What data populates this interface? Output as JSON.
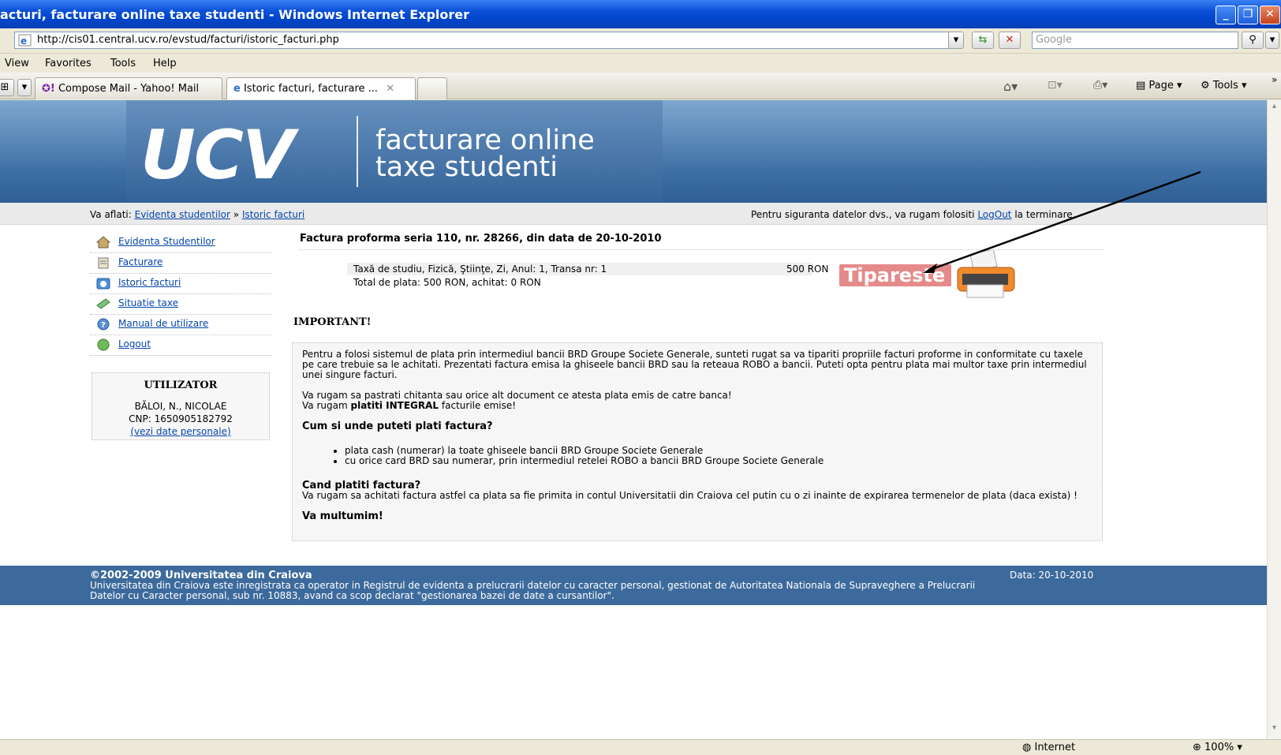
{
  "window": {
    "title": "acturi, facturare online taxe studenti - Windows Internet Explorer"
  },
  "address": {
    "url": "http://cis01.central.ucv.ro/evstud/facturi/istoric_facturi.php",
    "search_placeholder": "Google"
  },
  "menu": {
    "items": [
      "View",
      "Favorites",
      "Tools",
      "Help"
    ]
  },
  "tabs": {
    "items": [
      {
        "label": "Compose Mail - Yahoo! Mail"
      },
      {
        "label": "Istoric facturi, facturare ..."
      }
    ],
    "toolbar": {
      "page_label": "Page",
      "tools_label": "Tools"
    }
  },
  "banner": {
    "logo": "UCV",
    "line1": "facturare online",
    "line2": "taxe studenti"
  },
  "breadcrumb": {
    "prefix": "Va aflati:",
    "item1": "Evidenta studentilor",
    "sep": "»",
    "item2": "Istoric facturi",
    "notice_pre": "Pentru siguranta datelor dvs., va rugam folositi",
    "notice_link": "LogOut",
    "notice_post": "la terminare."
  },
  "sidebar": {
    "items": [
      {
        "label": "Evidenta Studentilor",
        "icon": "home-icon"
      },
      {
        "label": "Facturare",
        "icon": "invoice-icon"
      },
      {
        "label": "Istoric facturi",
        "icon": "history-icon"
      },
      {
        "label": "Situatie taxe",
        "icon": "money-icon"
      },
      {
        "label": "Manual de utilizare",
        "icon": "help-icon"
      },
      {
        "label": "Logout",
        "icon": "logout-icon"
      }
    ]
  },
  "user": {
    "heading": "UTILIZATOR",
    "name": "BĂLOI, N., NICOLAE",
    "cnp": "CNP: 1650905182792",
    "details_link": "(vezi date personale)"
  },
  "invoice": {
    "title": "Factura proforma seria 110, nr. 28266, din data de 20-10-2010",
    "line_desc": "Taxă de studiu, Fizică, Ştiinţe, Zi, Anul: 1, Transa nr: 1",
    "line_amount": "500 RON",
    "total": "Total de plata: 500 RON, achitat: 0 RON",
    "print_label": "Tipareste"
  },
  "important": {
    "heading": "IMPORTANT!",
    "para1": "Pentru a folosi sistemul de plata prin intermediul bancii BRD Groupe Societe Generale, sunteti rugat sa va tipariti propriile facturi proforme in conformitate cu taxele pe care trebuie sa le achitati. Prezentati factura emisa la ghiseele bancii BRD sau la reteaua ROBO a bancii. Puteti opta pentru plata mai multor taxe prin intermediul unei singure facturi.",
    "para2": "Va rugam sa pastrati chitanta sau orice alt document ce atesta plata emis de catre banca!",
    "para3_pre": "Va rugam",
    "para3_bold": "platiti INTEGRAL",
    "para3_post": "facturile emise!",
    "how_heading": "Cum si unde puteti plati factura?",
    "bullets": [
      "plata cash (numerar) la toate ghiseele bancii BRD Groupe Societe Generale",
      "cu orice card BRD sau numerar, prin intermediul retelei ROBO a bancii BRD Groupe Societe Generale"
    ],
    "when_heading": "Cand platiti factura?",
    "when_text": "Va rugam sa achitati factura astfel ca plata sa fie primita in contul Universitatii din Craiova cel putin cu o zi inainte de expirarea termenelor de plata (daca exista) !",
    "thanks": "Va multumim!"
  },
  "footer": {
    "copyright": "©2002-2009 Universitatea din Craiova",
    "text": "Universitatea din Craiova este inregistrata ca operator in Registrul de evidenta a prelucrarii datelor cu caracter personal, gestionat de Autoritatea Nationala de Supraveghere a Prelucrarii Datelor cu Caracter personal, sub nr. 10883, avand ca scop declarat \"gestionarea bazei de date a cursantilor\".",
    "date": "Data: 20-10-2010"
  },
  "status": {
    "zone": "Internet",
    "zoom": "100%"
  },
  "colors": {
    "banner": "#3d6fa5",
    "footer": "#3d6a9c",
    "print_button": "#e07a7a"
  }
}
